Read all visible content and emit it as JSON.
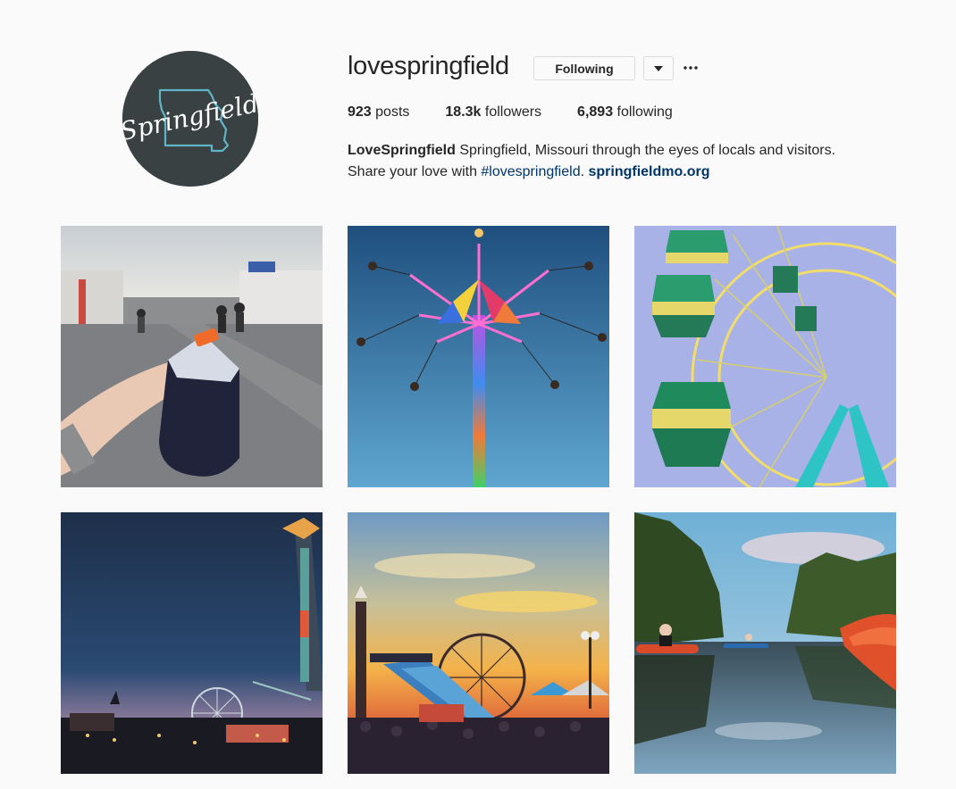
{
  "profile": {
    "username": "lovespringfield",
    "avatar_text": "Springfield",
    "follow_label": "Following",
    "dropdown_icon": "caret-down-icon",
    "more_icon": "ellipsis-icon",
    "stats": {
      "posts_count": "923",
      "posts_label": "posts",
      "followers_count": "18.3k",
      "followers_label": "followers",
      "following_count": "6,893",
      "following_label": "following"
    },
    "bio": {
      "name": "LoveSpringfield",
      "line1": "Springfield, Missouri through the eyes of locals and visitors.",
      "line2": "Share your love with ",
      "hashtag": "#lovespringfield",
      "separator": ". ",
      "link": "springfieldmo.org"
    }
  },
  "posts": [
    {
      "id": "post-1"
    },
    {
      "id": "post-2"
    },
    {
      "id": "post-3"
    },
    {
      "id": "post-4"
    },
    {
      "id": "post-5"
    },
    {
      "id": "post-6"
    }
  ],
  "colors": {
    "link": "#003569",
    "border": "#dbdbdb",
    "avatar_bg": "#3a4142",
    "avatar_accent": "#5fb5c6"
  }
}
